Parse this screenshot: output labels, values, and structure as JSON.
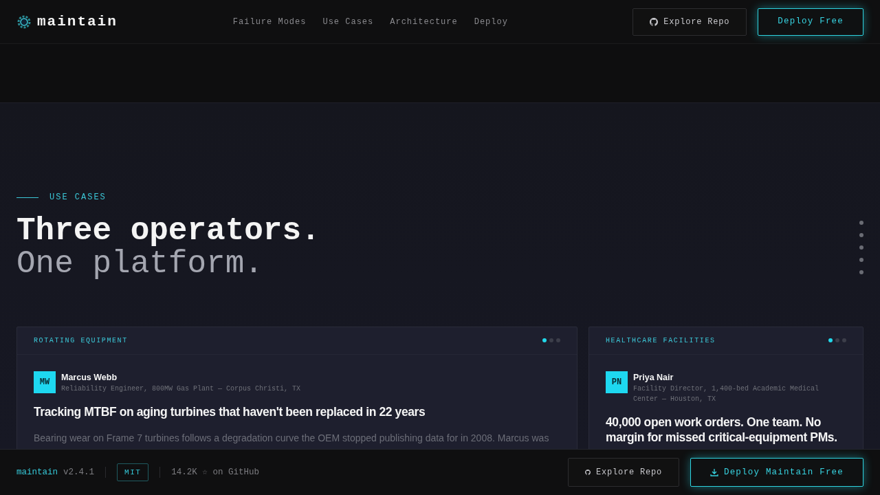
{
  "brand": "maintain",
  "nav": [
    "Failure Modes",
    "Use Cases",
    "Architecture",
    "Deploy"
  ],
  "header_buttons": [
    {
      "label": "Explore Repo",
      "kind": "outline"
    },
    {
      "label": "Deploy Free",
      "kind": "glow"
    }
  ],
  "section": {
    "eyebrow": "USE CASES",
    "title": "Three operators.",
    "subtitle": "One platform."
  },
  "cards": [
    {
      "category": "ROTATING EQUIPMENT",
      "slides": [
        {
          "selected": true
        },
        {
          "selected": false
        },
        {
          "selected": false
        }
      ],
      "initials": "MW",
      "name": "Marcus Webb",
      "role": "Reliability Engineer, 800MW Gas Plant — Corpus Christi, TX",
      "headline": "Tracking MTBF on aging turbines that haven't been replaced in 22 years",
      "body": "Bearing wear on Frame 7 turbines follows a degradation curve the OEM stopped publishing data for in 2008. Marcus was"
    },
    {
      "category": "HEALTHCARE FACILITIES",
      "slides": [
        {
          "selected": true
        },
        {
          "selected": false
        },
        {
          "selected": false
        }
      ],
      "initials": "PN",
      "name": "Priya Nair",
      "role": "Facility Director, 1,400-bed Academic Medical Center — Houston, TX",
      "headline": "40,000 open work orders. One team. No margin for missed critical-equipment PMs."
    }
  ],
  "footer": {
    "brand": "maintain",
    "version": "v2.4.1",
    "license": "MIT",
    "stars": "14.2K ☆ on GitHub",
    "buttons": [
      {
        "label": "Explore Repo",
        "kind": "outline"
      },
      {
        "label": "Deploy Maintain Free",
        "kind": "glow"
      }
    ]
  }
}
